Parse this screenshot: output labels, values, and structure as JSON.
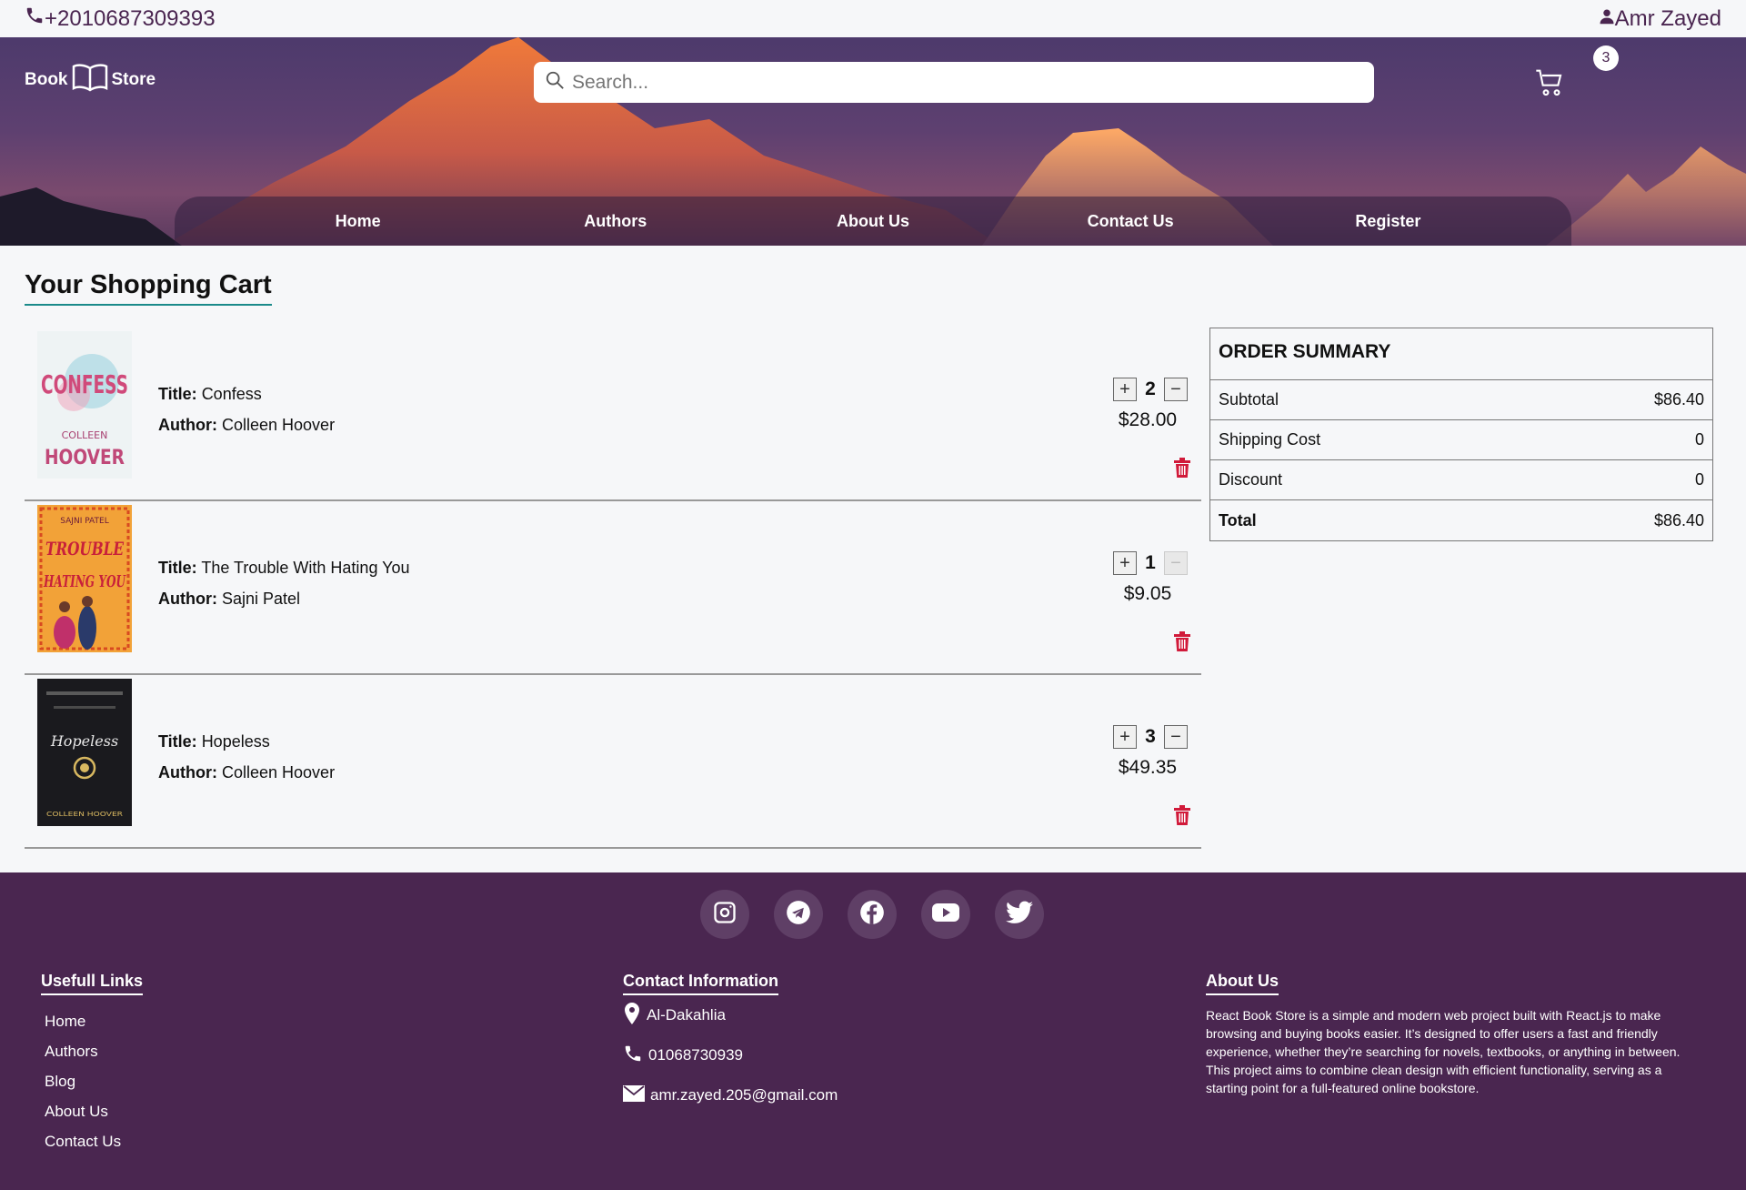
{
  "topbar": {
    "phone": "+2010687309393",
    "user": "Amr Zayed"
  },
  "header": {
    "logo_left": "Book",
    "logo_right": "Store",
    "search_placeholder": "Search...",
    "cart_count": "3",
    "nav": [
      "Home",
      "Authors",
      "About Us",
      "Contact Us",
      "Register"
    ]
  },
  "cart": {
    "title": "Your Shopping Cart",
    "title_label": "Title:",
    "author_label": "Author:",
    "items": [
      {
        "title": "Confess",
        "author": "Colleen Hoover",
        "qty": "2",
        "price": "$28.00",
        "cover_text_top": "CONFESS",
        "cover_text_bottom": "HOOVER",
        "cover_text_mid": "COLLEEN"
      },
      {
        "title": "The Trouble With Hating You",
        "author": "Sajni Patel",
        "qty": "1",
        "price": "$9.05",
        "cover_text_top": "SAJNI PATEL",
        "cover_text_bottom": "HATING YOU",
        "cover_text_mid": "TROUBLE"
      },
      {
        "title": "Hopeless",
        "author": "Colleen Hoover",
        "qty": "3",
        "price": "$49.35",
        "cover_text_top": "Hopeless",
        "cover_text_bottom": "COLLEEN HOOVER",
        "cover_text_mid": ""
      }
    ]
  },
  "summary": {
    "heading": "ORDER SUMMARY",
    "rows": [
      {
        "label": "Subtotal",
        "value": "$86.40"
      },
      {
        "label": "Shipping Cost",
        "value": "0"
      },
      {
        "label": "Discount",
        "value": "0"
      },
      {
        "label": "Total",
        "value": "$86.40"
      }
    ]
  },
  "footer": {
    "socials": [
      "instagram-icon",
      "telegram-icon",
      "facebook-icon",
      "youtube-icon",
      "twitter-icon"
    ],
    "links_heading": "Usefull Links",
    "links": [
      "Home",
      "Authors",
      "Blog",
      "About Us",
      "Contact Us"
    ],
    "contact_heading": "Contact Information",
    "location": "Al-Dakahlia",
    "phone": "01068730939",
    "email": "amr.zayed.205@gmail.com",
    "about_heading": "About Us",
    "about_text": "React Book Store is a simple and modern web project built with React.js to make browsing and buying books easier. It’s designed to offer users a fast and friendly experience, whether they’re searching for novels, textbooks, or anything in between. This project aims to combine clean design with efficient functionality, serving as a starting point for a full-featured online bookstore."
  },
  "colors": {
    "brand": "#4a2650",
    "accent": "#1a8a8a",
    "trash": "#d11a3a"
  }
}
